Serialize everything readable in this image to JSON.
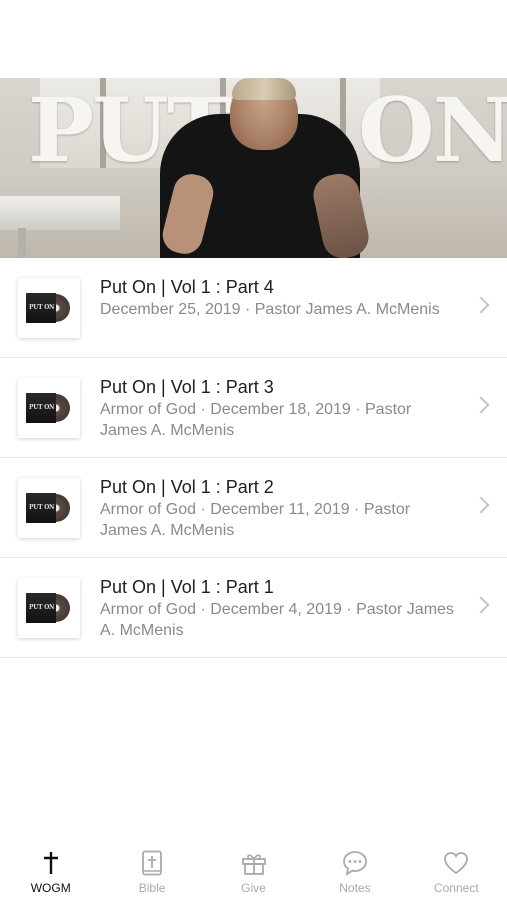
{
  "hero": {
    "title_left": "PUT",
    "title_right": "ON"
  },
  "episodes": [
    {
      "title": "Put On | Vol 1 : Part 4",
      "subtitle": "December 25, 2019 · Pastor James A. McMenis",
      "thumb_text": "PUT ON"
    },
    {
      "title": "Put On | Vol 1 : Part 3",
      "subtitle": "Armor of God · December 18, 2019 · Pastor James A. McMenis",
      "thumb_text": "PUT ON"
    },
    {
      "title": "Put On | Vol 1 : Part 2",
      "subtitle": "Armor of God · December 11, 2019 · Pastor James A. McMenis",
      "thumb_text": "PUT ON"
    },
    {
      "title": "Put On | Vol 1 : Part 1",
      "subtitle": "Armor of God · December 4, 2019 · Pastor James A. McMenis",
      "thumb_text": "PUT ON"
    }
  ],
  "tabbar": {
    "tabs": [
      {
        "label": "WOGM",
        "icon": "cross-icon",
        "active": true
      },
      {
        "label": "Bible",
        "icon": "bible-icon",
        "active": false
      },
      {
        "label": "Give",
        "icon": "gift-icon",
        "active": false
      },
      {
        "label": "Notes",
        "icon": "chat-bubble-icon",
        "active": false
      },
      {
        "label": "Connect",
        "icon": "heart-icon",
        "active": false
      }
    ]
  },
  "colors": {
    "active_tab": "#111111",
    "inactive_tab": "#a9a9a9",
    "subtitle": "#8a8a8a"
  }
}
